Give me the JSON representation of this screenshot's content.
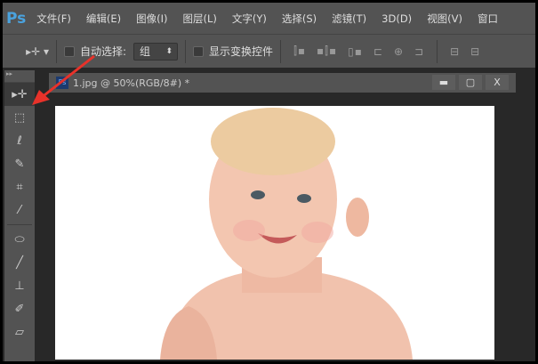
{
  "app": {
    "logo": "Ps"
  },
  "menu": [
    "文件(F)",
    "编辑(E)",
    "图像(I)",
    "图层(L)",
    "文字(Y)",
    "选择(S)",
    "滤镜(T)",
    "3D(D)",
    "视图(V)",
    "窗口"
  ],
  "options": {
    "move_tool": "▸✛ ▾",
    "auto_select_label": "自动选择:",
    "auto_select_value": "组",
    "show_transform_label": "显示变换控件",
    "align_icons": [
      "⫿▪",
      "▪⫿▪",
      "▯▪",
      "⊏",
      "⊕",
      "⊐",
      "⊟",
      "⊟"
    ]
  },
  "tools": [
    "move-tool",
    "marquee-tool",
    "lasso-tool",
    "quick-select-tool",
    "crop-tool",
    "eyedropper-tool",
    "healing-brush-tool",
    "brush-tool",
    "clone-stamp-tool",
    "history-brush-tool",
    "eraser-tool"
  ],
  "document": {
    "title": "1.jpg @ 50%(RGB/8#) *",
    "icon": "Ps",
    "buttons": {
      "minimize": "▬",
      "maximize": "▢",
      "close": "X"
    }
  },
  "colors": {
    "menubar": "#535353",
    "accent": "#4aa3df",
    "annotation": "#e8322a"
  }
}
